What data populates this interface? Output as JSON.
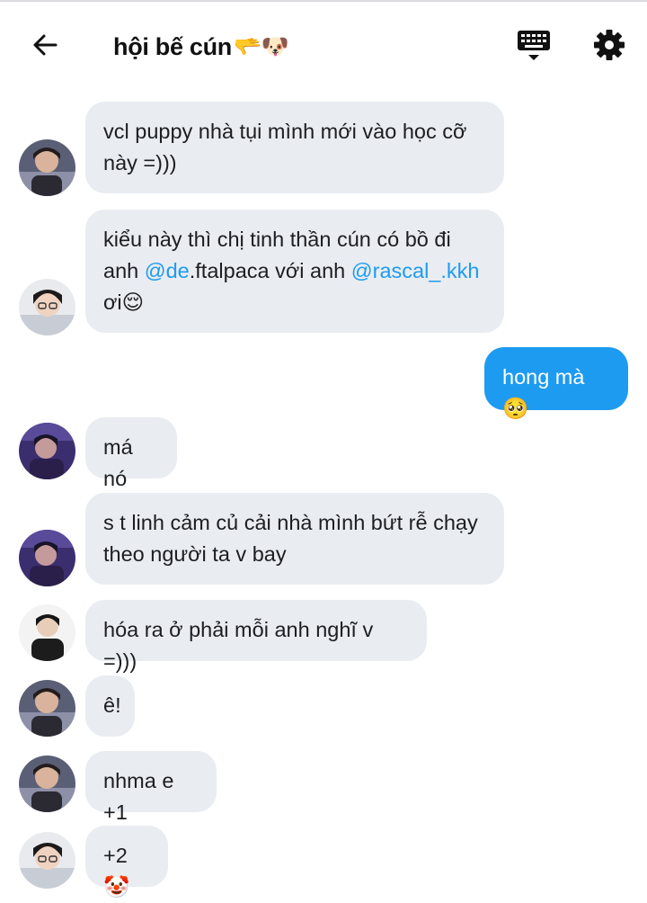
{
  "header": {
    "title": "hội bế cún",
    "title_emoji": "🫳🐶",
    "back_icon": "back-arrow-icon",
    "keyboard_icon": "keyboard-icon",
    "settings_icon": "gear-icon"
  },
  "colors": {
    "incoming_bubble": "#e9ecf0",
    "outgoing_bubble": "#1d9bf0",
    "mention": "#1d9bf0"
  },
  "messages": [
    {
      "text": "vcl puppy nhà tụi mình mới vào học cỡ này =)))"
    },
    {
      "text_1": "kiểu này thì chị tinh thần cún có bồ đi anh ",
      "mention_1": "@de",
      "text_2": ".ftalpaca với anh ",
      "mention_2": "@rascal_.kkh",
      "text_3": " ơi",
      "emoji": "😌"
    },
    {
      "text": "hong mà",
      "emoji": "🥺"
    },
    {
      "text": "má nó"
    },
    {
      "text": "s t linh cảm củ cải nhà mình bứt rễ chạy theo người ta v bay"
    },
    {
      "text": "hóa ra ở phải mỗi anh nghĩ v =)))"
    },
    {
      "text": "ê!"
    },
    {
      "text": "nhma e +1"
    },
    {
      "text": "+2",
      "emoji": "🤡"
    }
  ]
}
